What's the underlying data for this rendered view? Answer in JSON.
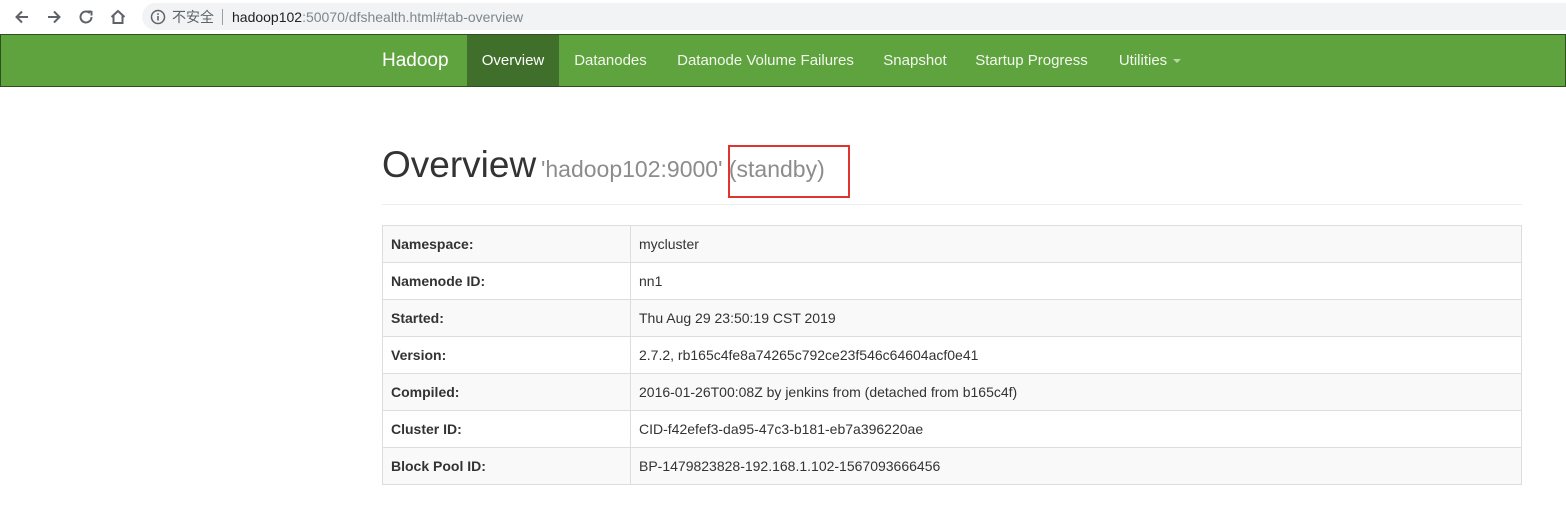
{
  "browser": {
    "insecure_label": "不安全",
    "url_host": "hadoop102",
    "url_rest": ":50070/dfshealth.html#tab-overview"
  },
  "navbar": {
    "brand": "Hadoop",
    "items": [
      {
        "label": "Overview",
        "active": true
      },
      {
        "label": "Datanodes"
      },
      {
        "label": "Datanode Volume Failures"
      },
      {
        "label": "Snapshot"
      },
      {
        "label": "Startup Progress"
      },
      {
        "label": "Utilities"
      }
    ]
  },
  "header": {
    "title": "Overview",
    "address": "'hadoop102:9000'",
    "state": "(standby)"
  },
  "overview": {
    "rows": [
      {
        "key": "Namespace:",
        "value": "mycluster"
      },
      {
        "key": "Namenode ID:",
        "value": "nn1"
      },
      {
        "key": "Started:",
        "value": "Thu Aug 29 23:50:19 CST 2019"
      },
      {
        "key": "Version:",
        "value": "2.7.2, rb165c4fe8a74265c792ce23f546c64604acf0e41"
      },
      {
        "key": "Compiled:",
        "value": "2016-01-26T00:08Z by jenkins from (detached from b165c4f)"
      },
      {
        "key": "Cluster ID:",
        "value": "CID-f42efef3-da95-47c3-b181-eb7a396220ae"
      },
      {
        "key": "Block Pool ID:",
        "value": "BP-1479823828-192.168.1.102-1567093666456"
      }
    ]
  },
  "colors": {
    "navbar": "#5fa33e",
    "navbar_active": "#3f6f2a",
    "highlight_box": "#e0342f"
  }
}
